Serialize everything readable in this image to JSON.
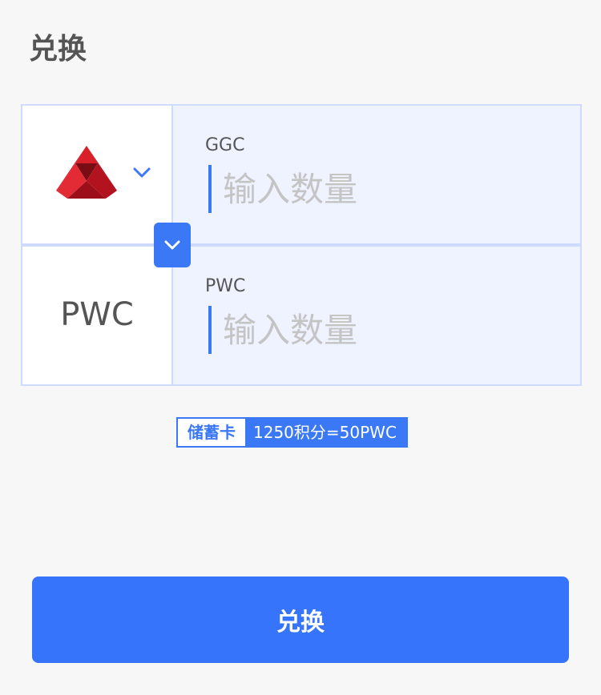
{
  "page": {
    "title": "兑换"
  },
  "from": {
    "coin_icon": "red-triangle-logo-icon",
    "dropdown_icon": "chevron-down-icon",
    "label": "GGC",
    "placeholder": "输入数量"
  },
  "swap": {
    "icon": "chevron-down-icon"
  },
  "to": {
    "coin": "PWC",
    "label": "PWC",
    "placeholder": "输入数量"
  },
  "rate": {
    "tag": "储蓄卡",
    "text": "1250积分=50PWC"
  },
  "submit": {
    "label": "兑换"
  },
  "colors": {
    "accent": "#3674fb",
    "panel_border": "#cfdaff",
    "input_bg": "#eef3ff",
    "logo_red": "#c8102e"
  }
}
